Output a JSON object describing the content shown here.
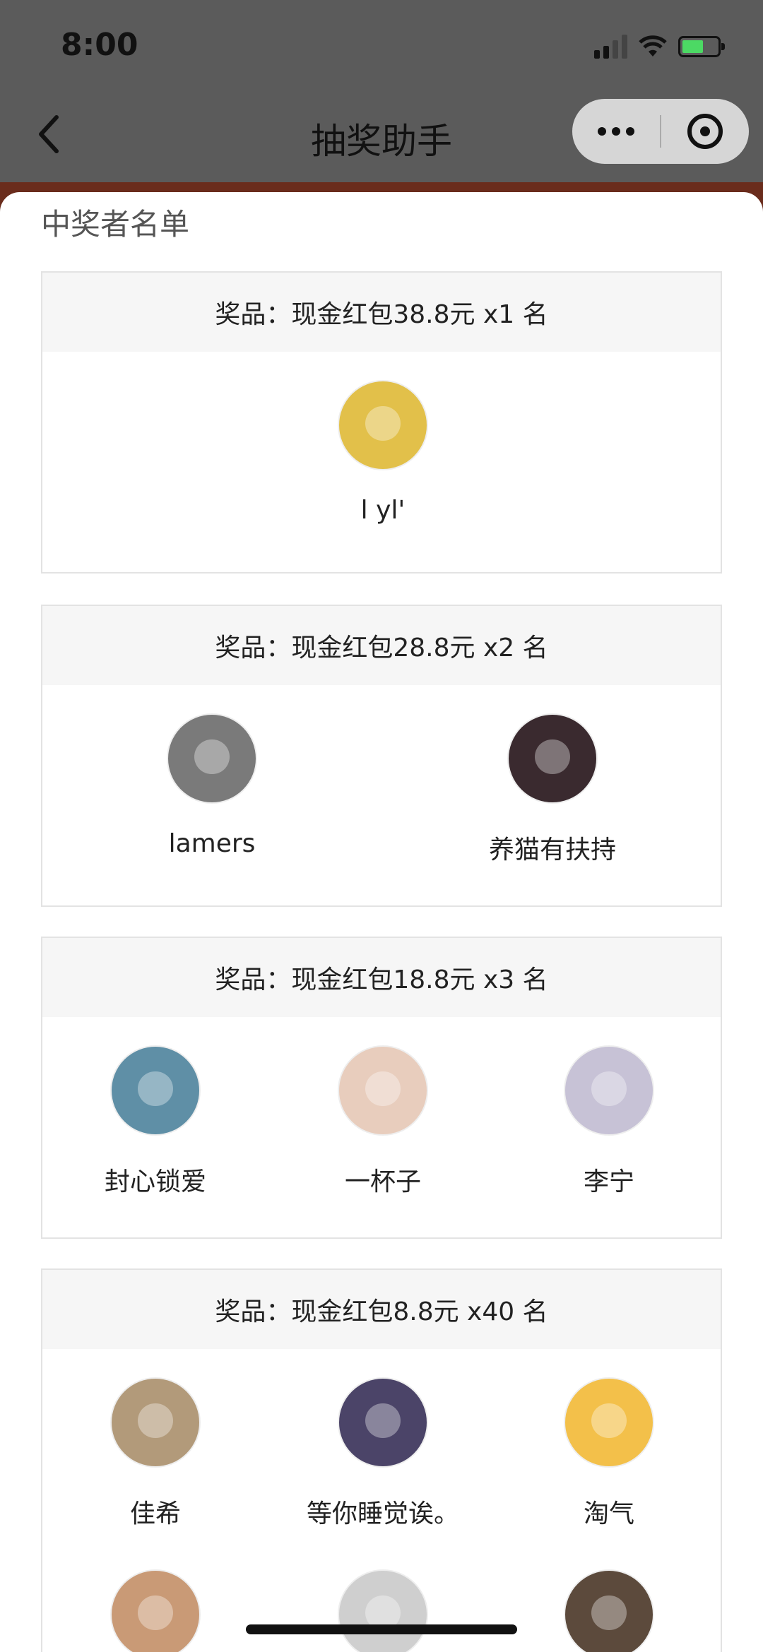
{
  "status_bar": {
    "time": "8:00"
  },
  "navbar": {
    "title": "抽奖助手"
  },
  "section_title": "中奖者名单",
  "prizes": [
    {
      "label": "奖品：现金红包38.8元 x1 名",
      "winners": [
        {
          "name": "l yl'",
          "color": "#e2c04a"
        }
      ]
    },
    {
      "label": "奖品：现金红包28.8元 x2 名",
      "winners": [
        {
          "name": "lamers",
          "color": "#7a7a7a"
        },
        {
          "name": "养猫有扶持",
          "color": "#3a2a2f"
        }
      ]
    },
    {
      "label": "奖品：现金红包18.8元 x3 名",
      "winners": [
        {
          "name": "封心锁爱",
          "color": "#5f8fa6"
        },
        {
          "name": "一杯子",
          "color": "#e8cdbd"
        },
        {
          "name": "李宁",
          "color": "#c7c2d6"
        }
      ]
    },
    {
      "label": "奖品：现金红包8.8元 x40 名",
      "winners": [
        {
          "name": "佳希",
          "color": "#b29a7a"
        },
        {
          "name": "等你睡觉诶。",
          "color": "#4b4468"
        },
        {
          "name": "淘气",
          "color": "#f3c04a"
        }
      ]
    }
  ],
  "partial_avatars": [
    {
      "color": "#c99a76"
    },
    {
      "color": "#cfcfcf"
    },
    {
      "color": "#5c4a3c"
    }
  ]
}
